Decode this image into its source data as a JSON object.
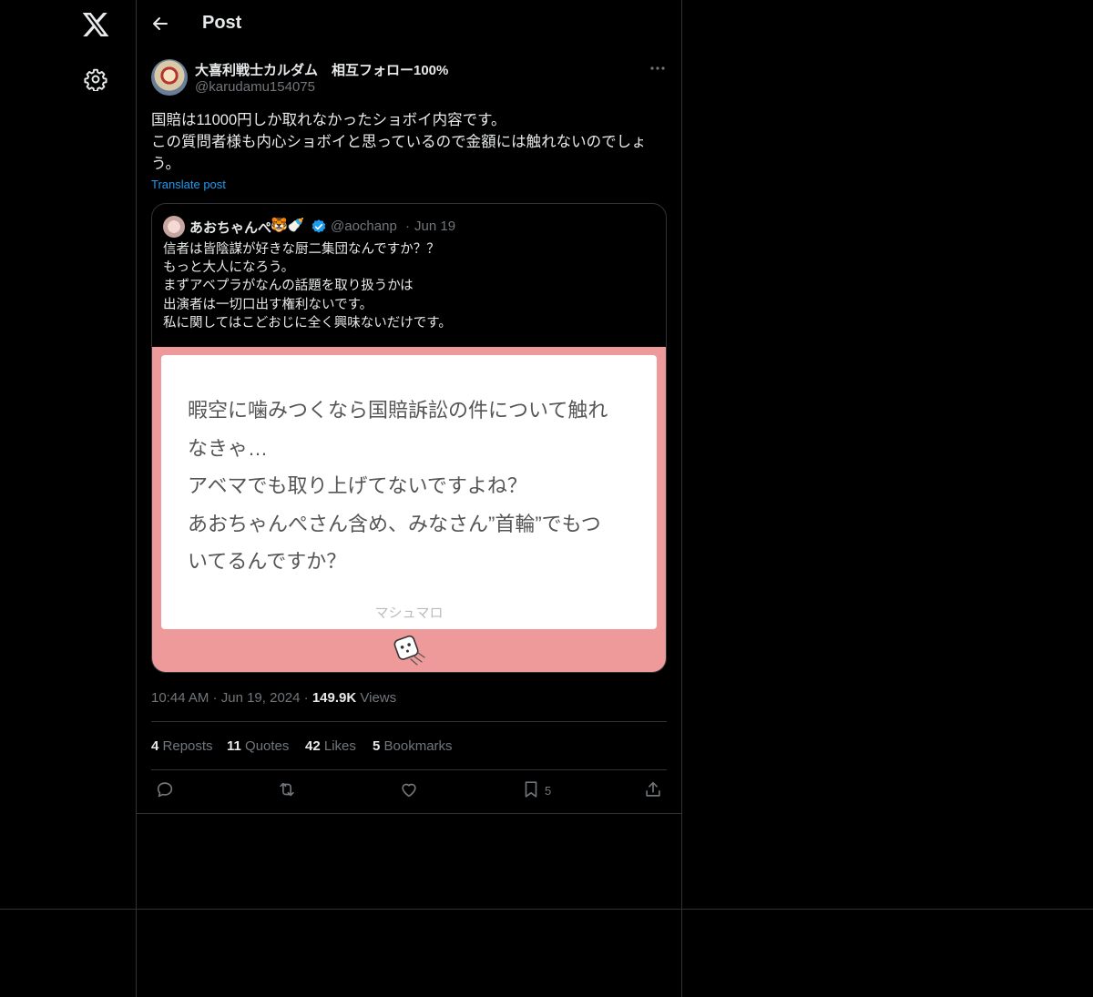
{
  "nav": {
    "logo_icon": "x-logo-icon",
    "settings_icon": "gear-icon"
  },
  "header": {
    "title": "Post",
    "back_icon": "arrow-left-icon"
  },
  "post": {
    "author_name": "大喜利戦士カルダム　相互フォロー100%",
    "author_handle": "@karudamu154075",
    "text_lines": [
      "国賠は11000円しか取れなかったショボイ内容です。",
      "この質問者様も内心ショボイと思っているので金額には触れないのでしょ",
      "う。"
    ],
    "translate_label": "Translate post",
    "time": "10:44 AM",
    "date": "Jun 19, 2024",
    "views_count": "149.9K",
    "views_label": "Views",
    "separator": "·"
  },
  "quote": {
    "author_name": "あおちゃんぺ",
    "author_emoji": "🐯🍼",
    "verified": true,
    "handle": "@aochanp",
    "date": "Jun 19",
    "dot": "·",
    "text_lines": [
      "信者は皆陰謀が好きな厨二集団なんですか？？",
      "もっと大人になろう。",
      "まずアベプラがなんの話題を取り扱うかは",
      "出演者は一切口出す権利ないです。",
      "私に関してはこどおじに全く興味ないだけです。"
    ],
    "media": {
      "background_color": "#ef9a9a",
      "card_lines": [
        "暇空に噛みつくなら国賠訴訟の件について触れ",
        "なきゃ…",
        "アベマでも取り上げてないですよね？",
        "あおちゃんぺさん含め、みなさん”首輪”でもつ",
        "いてるんですか？"
      ],
      "footer": "マシュマロ"
    }
  },
  "stats": {
    "reposts_count": "4",
    "reposts_label": "Reposts",
    "quotes_count": "11",
    "quotes_label": "Quotes",
    "likes_count": "42",
    "likes_label": "Likes",
    "bookmarks_count": "5",
    "bookmarks_label": "Bookmarks"
  },
  "actions": {
    "reply_icon": "reply-icon",
    "repost_icon": "repost-icon",
    "like_icon": "heart-icon",
    "bookmark_icon": "bookmark-icon",
    "bookmark_count": "5",
    "share_icon": "share-icon"
  },
  "colors": {
    "background": "#000000",
    "text": "#e7e9ea",
    "muted": "#71767b",
    "accent": "#1d9bf0",
    "border": "#2f3336"
  }
}
